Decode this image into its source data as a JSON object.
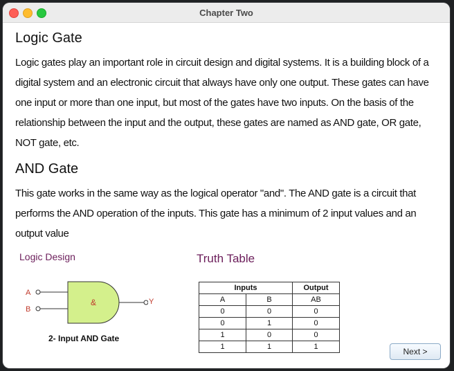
{
  "window": {
    "title": "Chapter Two"
  },
  "sections": [
    {
      "heading": "Logic Gate",
      "body": "Logic gates play an important role in circuit design and digital systems. It is a building block of a digital system and an electronic circuit that always have only one output. These gates can have one input or more than one input, but most of the gates have two inputs. On the basis of the relationship between the input and the output, these gates are named as AND gate, OR gate, NOT gate, etc."
    },
    {
      "heading": "AND Gate",
      "body": "This gate works in the same way as the logical operator \"and\". The AND gate is a circuit that performs the AND operation of the inputs. This gate has a minimum of 2 input values and an output value"
    }
  ],
  "diagram": {
    "label": "Logic Design",
    "input_a": "A",
    "input_b": "B",
    "output": "Y",
    "symbol": "&",
    "caption": "2- Input AND Gate",
    "colors": {
      "gate_fill": "#d4f08c",
      "input_label": "#c0392b",
      "output_label": "#c0392b",
      "symbol": "#c0392b"
    }
  },
  "truth_table": {
    "label": "Truth Table",
    "group_headers": [
      "Inputs",
      "Output"
    ],
    "columns": [
      "A",
      "B",
      "AB"
    ],
    "rows": [
      [
        "0",
        "0",
        "0"
      ],
      [
        "0",
        "1",
        "0"
      ],
      [
        "1",
        "0",
        "0"
      ],
      [
        "1",
        "1",
        "1"
      ]
    ]
  },
  "footer": {
    "next_label": "Next >"
  }
}
